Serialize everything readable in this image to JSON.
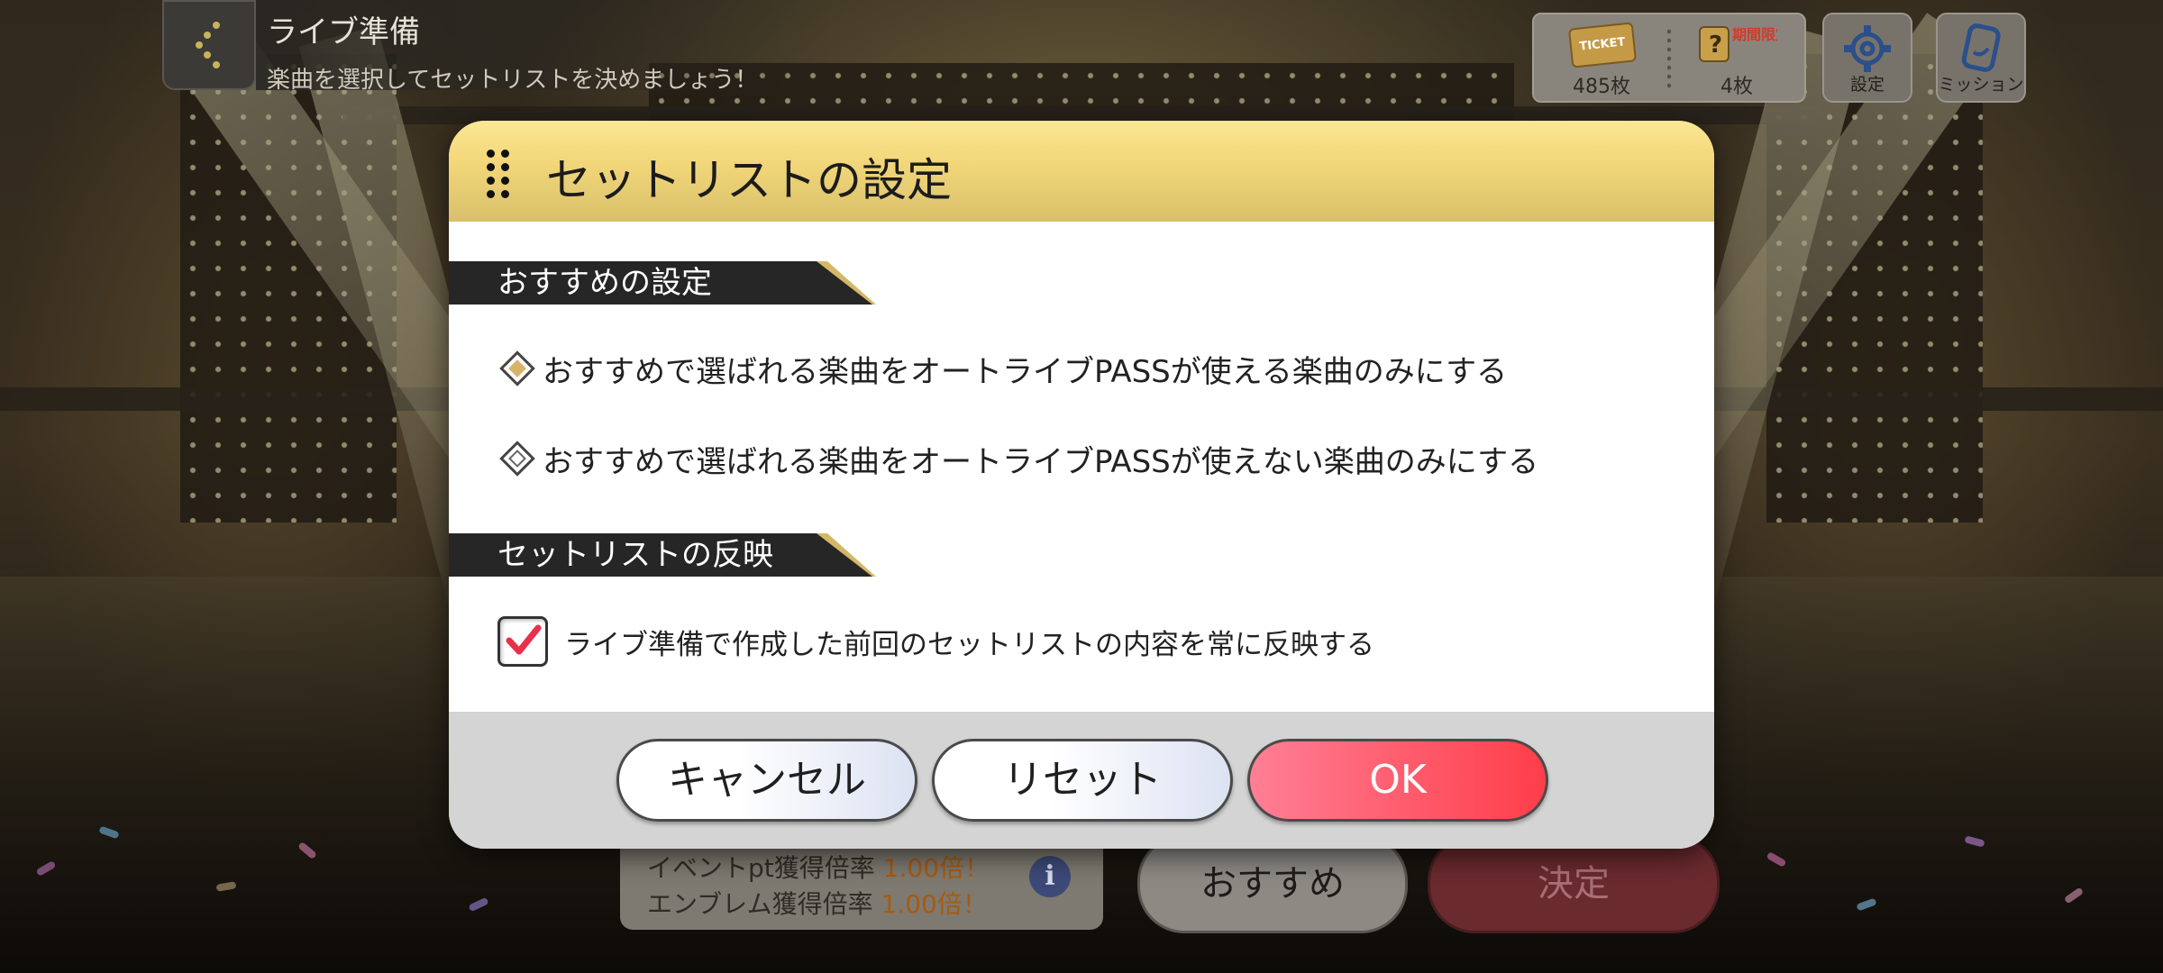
{
  "header": {
    "title": "ライブ準備",
    "subtitle": "楽曲を選択してセットリストを決めましょう！"
  },
  "currencies": [
    {
      "icon": "ticket-icon",
      "icon_text": "TICKET",
      "count": "485枚"
    },
    {
      "icon": "limited-ticket-icon",
      "icon_text": "期間限定",
      "count": "4枚"
    }
  ],
  "top_buttons": {
    "settings": "設定",
    "mission": "ミッション"
  },
  "bottom": {
    "event_rate_label": "イベントpt獲得倍率",
    "event_rate_value": "1.00倍！",
    "emblem_rate_label": "エンブレム獲得倍率",
    "emblem_rate_value": "1.00倍！",
    "info": "i",
    "recommend": "おすすめ",
    "decide": "決定"
  },
  "dialog": {
    "title": "セットリストの設定",
    "section_recommend": "おすすめの設定",
    "option_pass_only": "おすすめで選ばれる楽曲をオートライブPASSが使える楽曲のみにする",
    "option_pass_none": "おすすめで選ばれる楽曲をオートライブPASSが使えない楽曲のみにする",
    "selected_option": "option_pass_only",
    "section_reflect": "セットリストの反映",
    "reflect_checkbox": "ライブ準備で作成した前回のセットリストの内容を常に反映する",
    "reflect_checked": true,
    "cancel": "キャンセル",
    "reset": "リセット",
    "ok": "OK"
  },
  "colors": {
    "dialog_header": "#f3d77a",
    "ok_button": "#ff3d4a",
    "check_mark": "#e8304a",
    "selected_diamond": "#d7b46a"
  }
}
